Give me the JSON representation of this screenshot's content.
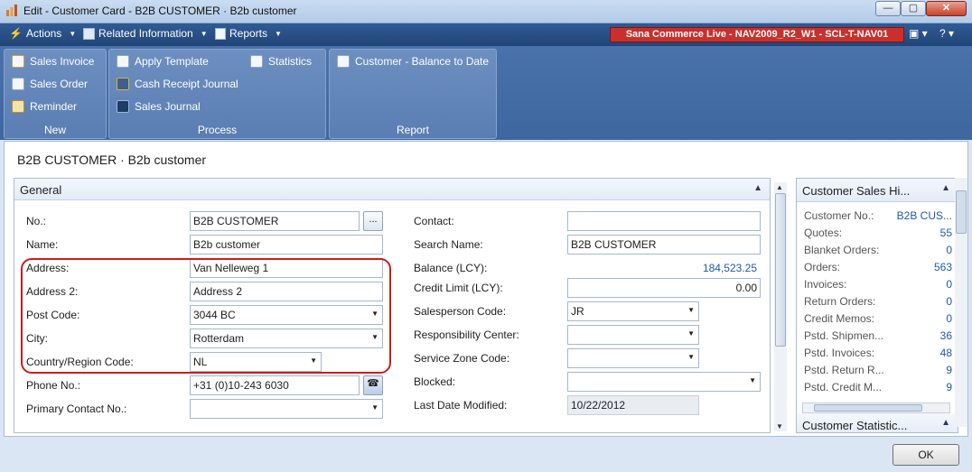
{
  "window": {
    "title": "Edit - Customer Card - B2B CUSTOMER · B2b customer",
    "min_label": "—",
    "max_label": "▢",
    "close_label": "✕"
  },
  "command_bar": {
    "actions": "Actions",
    "related": "Related Information",
    "reports": "Reports",
    "environment": "Sana Commerce Live - NAV2009_R2_W1 - SCL-T-NAV01",
    "help": "?"
  },
  "ribbon": {
    "new": {
      "title": "New",
      "items": [
        "Sales Invoice",
        "Sales Order",
        "Reminder"
      ]
    },
    "process": {
      "title": "Process",
      "items": [
        "Apply Template",
        "Cash Receipt Journal",
        "Sales Journal",
        "Statistics"
      ]
    },
    "report": {
      "title": "Report",
      "items": [
        "Customer - Balance to Date"
      ]
    }
  },
  "page": {
    "title": "B2B CUSTOMER · B2b customer"
  },
  "general": {
    "title": "General",
    "left": {
      "no_label": "No.:",
      "no_value": "B2B CUSTOMER",
      "no_button": "...",
      "name_label": "Name:",
      "name_value": "B2b customer",
      "address_label": "Address:",
      "address_value": "Van Nelleweg 1",
      "address2_label": "Address 2:",
      "address2_value": "Address 2",
      "postcode_label": "Post Code:",
      "postcode_value": "3044 BC",
      "city_label": "City:",
      "city_value": "Rotterdam",
      "country_label": "Country/Region Code:",
      "country_value": "NL",
      "phone_label": "Phone No.:",
      "phone_value": "+31 (0)10-243 6030",
      "primary_contact_label": "Primary Contact No.:",
      "primary_contact_value": ""
    },
    "right": {
      "contact_label": "Contact:",
      "contact_value": "",
      "search_name_label": "Search Name:",
      "search_name_value": "B2B CUSTOMER",
      "balance_label": "Balance (LCY):",
      "balance_value": "184,523.25",
      "credit_limit_label": "Credit Limit (LCY):",
      "credit_limit_value": "0.00",
      "salesperson_label": "Salesperson Code:",
      "salesperson_value": "JR",
      "resp_center_label": "Responsibility Center:",
      "resp_center_value": "",
      "service_zone_label": "Service Zone Code:",
      "service_zone_value": "",
      "blocked_label": "Blocked:",
      "blocked_value": "",
      "last_modified_label": "Last Date Modified:",
      "last_modified_value": "10/22/2012"
    }
  },
  "factbox": {
    "title": "Customer Sales Hi...",
    "rows": [
      {
        "k": "Customer No.:",
        "v": "B2B CUS..."
      },
      {
        "k": "Quotes:",
        "v": "55"
      },
      {
        "k": "Blanket Orders:",
        "v": "0"
      },
      {
        "k": "Orders:",
        "v": "563"
      },
      {
        "k": "Invoices:",
        "v": "0"
      },
      {
        "k": "Return Orders:",
        "v": "0"
      },
      {
        "k": "Credit Memos:",
        "v": "0"
      },
      {
        "k": "Pstd. Shipmen...",
        "v": "36"
      },
      {
        "k": "Pstd. Invoices:",
        "v": "48"
      },
      {
        "k": "Pstd. Return R...",
        "v": "9"
      },
      {
        "k": "Pstd. Credit M...",
        "v": "9"
      }
    ],
    "second_title": "Customer Statistic..."
  },
  "footer": {
    "ok_label": "OK"
  },
  "colors": {
    "command_bar": "#214577",
    "ribbon": "#4a72aa",
    "environment_badge": "#c9302c",
    "highlight": "#cc1d1d",
    "link": "#1f5aa8"
  }
}
